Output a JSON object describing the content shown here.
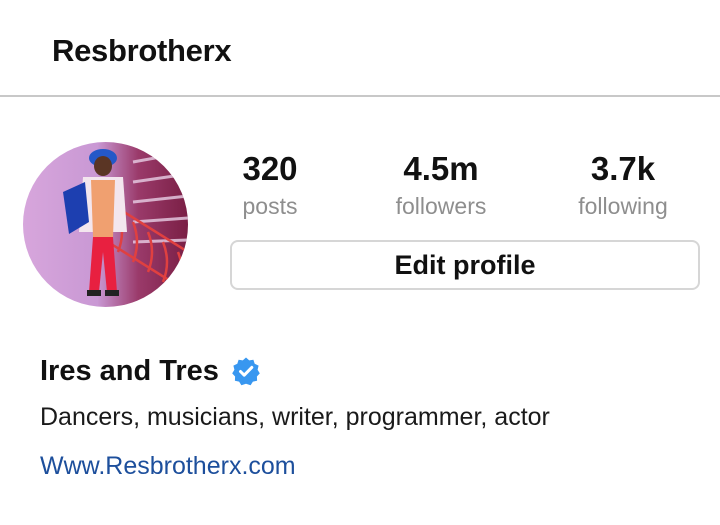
{
  "header": {
    "username": "Resbrotherx"
  },
  "profile": {
    "stats": [
      {
        "value": "320",
        "label": "posts"
      },
      {
        "value": "4.5m",
        "label": "followers"
      },
      {
        "value": "3.7k",
        "label": "following"
      }
    ],
    "edit_label": "Edit profile",
    "display_name": "Ires and Tres",
    "verified": true,
    "bio": "Dancers, musicians, writer, programmer, actor",
    "link": "Www.Resbrotherx.com"
  },
  "colors": {
    "verified_badge": "#3897f0",
    "link": "#1d4f9c",
    "muted_text": "#8e8e8e",
    "divider": "#c8c8c8"
  },
  "icons": {
    "verified": "verified-badge-icon"
  }
}
